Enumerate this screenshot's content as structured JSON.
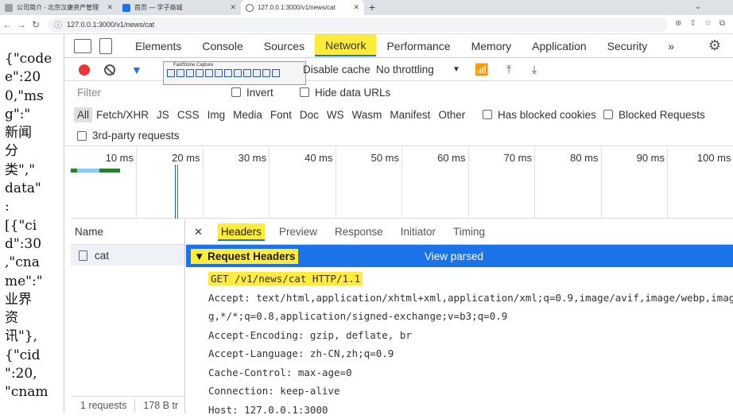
{
  "browser": {
    "tabs": [
      {
        "label": "公司简介 - 北京汉康资产管理",
        "favicon_color": "#9e9e9e"
      },
      {
        "label": "首页 — 学子商城",
        "favicon_color": "#1a73e8"
      },
      {
        "label": "127.0.0.1:3000/v1/news/cat",
        "favicon_color": "#555555"
      }
    ],
    "new_tab": "+",
    "url": "127.0.0.1:3000/v1/news/cat"
  },
  "page": {
    "json_lines": [
      "{\"code",
      "e\":20",
      "0,\"ms",
      "g\":\"",
      "新闻",
      "分",
      "类\",\"",
      "data\"",
      ":",
      "[{\"ci",
      "d\":30",
      ",\"cna",
      "me\":\"",
      "业界",
      "资",
      "讯\"},",
      "{\"cid",
      "\":20,",
      "\"cnam"
    ]
  },
  "devtools": {
    "tabs": [
      "Elements",
      "Console",
      "Sources",
      "Network",
      "Performance",
      "Memory",
      "Application",
      "Security"
    ],
    "active_tab": "Network",
    "more": "»",
    "toolbar": {
      "capture_title": "FastStone Capture",
      "disable_cache": "Disable cache",
      "throttling": "No throttling"
    },
    "filter": {
      "placeholder": "Filter",
      "invert": "Invert",
      "hide_data_urls": "Hide data URLs",
      "types": [
        "All",
        "Fetch/XHR",
        "JS",
        "CSS",
        "Img",
        "Media",
        "Font",
        "Doc",
        "WS",
        "Wasm",
        "Manifest",
        "Other"
      ],
      "has_blocked_cookies": "Has blocked cookies",
      "blocked_requests": "Blocked Requests",
      "third_party": "3rd-party requests"
    },
    "timeline_ticks": [
      "10 ms",
      "20 ms",
      "30 ms",
      "40 ms",
      "50 ms",
      "60 ms",
      "70 ms",
      "80 ms",
      "90 ms",
      "100 ms"
    ],
    "request_list": {
      "header": "Name",
      "items": [
        "cat"
      ],
      "status_requests": "1 requests",
      "status_size": "178 B tr"
    },
    "details": {
      "tabs": [
        "Headers",
        "Preview",
        "Response",
        "Initiator",
        "Timing"
      ],
      "active_tab": "Headers",
      "section_title": "▼ Request Headers",
      "view_parsed": "View parsed",
      "request_line": "GET /v1/news/cat HTTP/1.1",
      "headers": [
        "Accept: text/html,application/xhtml+xml,application/xml;q=0.9,image/avif,image/webp,image",
        "g,*/*;q=0.8,application/signed-exchange;v=b3;q=0.9",
        "Accept-Encoding: gzip, deflate, br",
        "Accept-Language: zh-CN,zh;q=0.9",
        "Cache-Control: max-age=0",
        "Connection: keep-alive",
        "Host: 127.0.0.1:3000"
      ]
    }
  }
}
